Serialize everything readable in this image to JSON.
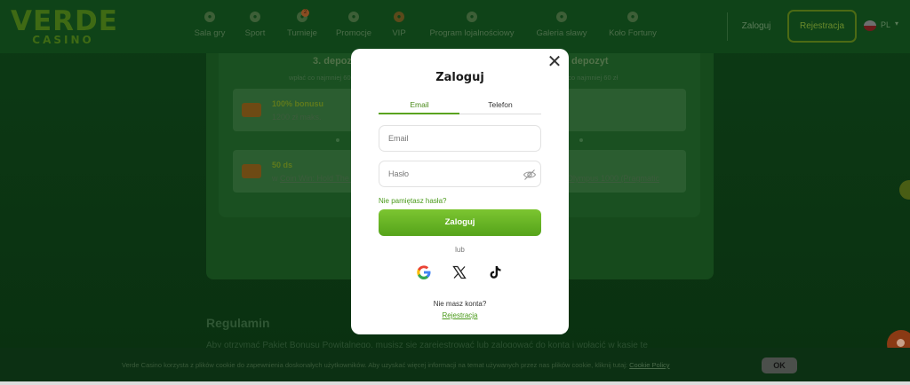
{
  "header": {
    "logo": {
      "main": "VERDE",
      "sub": "CASINO"
    },
    "nav": [
      {
        "label": "Sala gry",
        "icon": "slot-icon"
      },
      {
        "label": "Sport",
        "icon": "ball-icon"
      },
      {
        "label": "Turnieje",
        "icon": "trophy-icon",
        "badge": "2"
      },
      {
        "label": "Promocje",
        "icon": "gift-icon"
      },
      {
        "label": "VIP",
        "icon": "crown-icon"
      },
      {
        "label": "Program lojalnościowy",
        "icon": "crown-star-icon"
      },
      {
        "label": "Galeria sławy",
        "icon": "flame-icon"
      },
      {
        "label": "Koło Fortuny",
        "icon": "wheel-icon"
      }
    ],
    "login_label": "Zaloguj",
    "register_label": "Rejestracja",
    "language": "PL"
  },
  "background": {
    "columns": [
      {
        "title": "3. depozyt",
        "subtitle": "wpłać co najmniej 60 zł"
      },
      {
        "title": "depozyt",
        "subtitle": "wpłać co najmniej 60 zł"
      }
    ],
    "cards": [
      {
        "title": "100% bonusu",
        "text": "1200 zł maks."
      },
      {
        "title": "50 ds",
        "text_prefix": "w ",
        "link": "Coin Win: Hold The Spin"
      },
      {
        "link": "Olympus 1000 (Pragmatic"
      }
    ],
    "section_title": "Regulamin",
    "section_text": "Aby otrzymać Pakiet Bonusu Powitalnego, musisz się zarejestrować lub zalogować do konta i wpłacić w kasie te"
  },
  "cookie": {
    "text": "Verde Casino korzysta z plików cookie do zapewnienia doskonałych użytkowników. Aby uzyskać więcej informacji na temat używanych przez nas plików cookie, kliknij tutaj:",
    "link": "Cookie Policy",
    "ok_label": "OK"
  },
  "modal": {
    "title": "Zaloguj",
    "tabs": [
      {
        "label": "Email",
        "active": true
      },
      {
        "label": "Telefon",
        "active": false
      }
    ],
    "email_placeholder": "Email",
    "password_placeholder": "Hasło",
    "forgot_label": "Nie pamiętasz hasła?",
    "submit_label": "Zaloguj",
    "or_label": "lub",
    "social": [
      "google-icon",
      "x-icon",
      "tiktok-icon"
    ],
    "no_account_label": "Nie masz konta?",
    "register_label": "Rejestracja"
  },
  "colors": {
    "accent_green": "#5aa31f",
    "backdrop": "#0d3a15"
  }
}
